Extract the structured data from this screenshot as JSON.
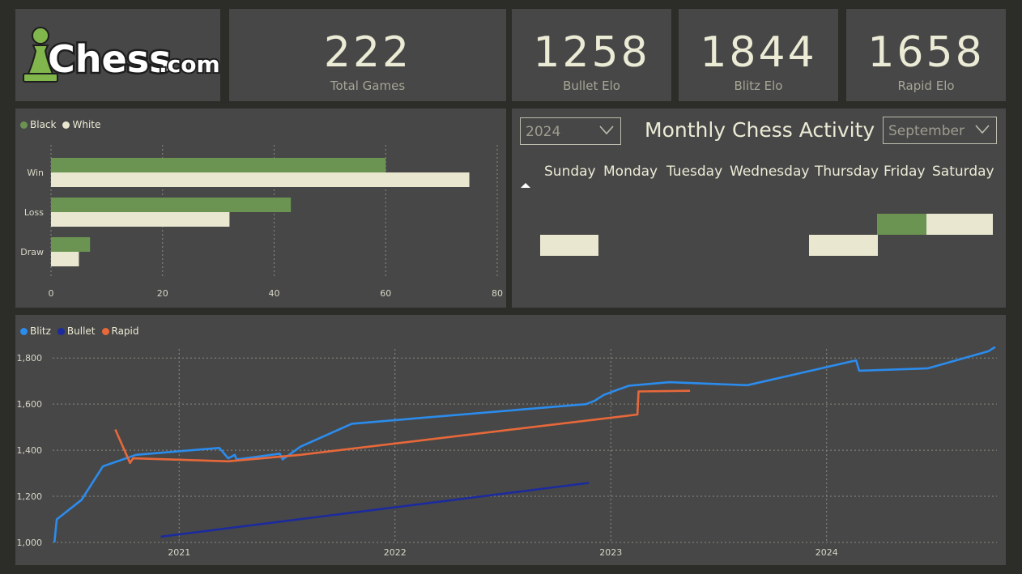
{
  "brand": {
    "logo_text": "Chess",
    "logo_suffix": ".com"
  },
  "kpis": [
    {
      "value": "222",
      "label": "Total Games"
    },
    {
      "value": "1258",
      "label": "Bullet Elo"
    },
    {
      "value": "1844",
      "label": "Blitz Elo"
    },
    {
      "value": "1658",
      "label": "Rapid Elo"
    }
  ],
  "colors": {
    "black": "#6b9452",
    "white": "#e9e7cf",
    "blitz": "#2b8ced",
    "bullet": "#1b2b9e",
    "rapid": "#e8683a",
    "panel": "#474747",
    "background": "#2c2c28"
  },
  "results_chart": {
    "legend": [
      "Black",
      "White"
    ],
    "categories": [
      "Win",
      "Loss",
      "Draw"
    ],
    "series": [
      {
        "name": "Black",
        "values": [
          60,
          43,
          7
        ]
      },
      {
        "name": "White",
        "values": [
          75,
          32,
          5
        ]
      }
    ],
    "x_ticks": [
      "0",
      "20",
      "40",
      "60",
      "80"
    ],
    "xlim": [
      0,
      80
    ]
  },
  "activity": {
    "title": "Monthly Chess Activity",
    "year_select": "2024",
    "month_select": "September",
    "days": [
      "Sunday",
      "Monday",
      "Tuesday",
      "Wednesday",
      "Thursday",
      "Friday",
      "Saturday"
    ],
    "sort_icon": "sort-up-icon"
  },
  "chart_data": [
    {
      "type": "bar",
      "orientation": "horizontal",
      "categories": [
        "Win",
        "Loss",
        "Draw"
      ],
      "series": [
        {
          "name": "Black",
          "values": [
            60,
            43,
            7
          ]
        },
        {
          "name": "White",
          "values": [
            75,
            32,
            5
          ]
        }
      ],
      "xlim": [
        0,
        80
      ],
      "legend": "top-left",
      "grid": true
    },
    {
      "type": "line",
      "legend": "top-left",
      "grid": true,
      "ylim": [
        1000,
        1850
      ],
      "y_ticks": [
        "1,000",
        "1,200",
        "1,400",
        "1,600",
        "1,800"
      ],
      "x_ticks": [
        "2021",
        "2022",
        "2023",
        "2024"
      ],
      "x_tick_values": [
        "2021-01-01",
        "2022-01-01",
        "2023-01-01",
        "2024-01-01"
      ],
      "xlim": [
        "2020-06-01",
        "2024-10-15"
      ],
      "series": [
        {
          "name": "Blitz",
          "points": [
            [
              "2020-06-04",
              1000
            ],
            [
              "2020-06-08",
              1100
            ],
            [
              "2020-07-20",
              1185
            ],
            [
              "2020-08-25",
              1330
            ],
            [
              "2020-10-20",
              1380
            ],
            [
              "2021-03-10",
              1410
            ],
            [
              "2021-03-25",
              1365
            ],
            [
              "2021-04-05",
              1380
            ],
            [
              "2021-04-08",
              1360
            ],
            [
              "2021-06-20",
              1385
            ],
            [
              "2021-06-25",
              1360
            ],
            [
              "2021-07-25",
              1415
            ],
            [
              "2021-10-20",
              1515
            ],
            [
              "2022-11-20",
              1600
            ],
            [
              "2022-12-05",
              1615
            ],
            [
              "2022-12-20",
              1640
            ],
            [
              "2023-01-10",
              1660
            ],
            [
              "2023-02-01",
              1680
            ],
            [
              "2023-04-10",
              1695
            ],
            [
              "2023-08-20",
              1682
            ],
            [
              "2024-02-20",
              1790
            ],
            [
              "2024-02-25",
              1745
            ],
            [
              "2024-06-20",
              1755
            ],
            [
              "2024-10-01",
              1830
            ],
            [
              "2024-10-12",
              1848
            ]
          ]
        },
        {
          "name": "Bullet",
          "points": [
            [
              "2020-12-01",
              1025
            ],
            [
              "2022-11-25",
              1258
            ]
          ]
        },
        {
          "name": "Rapid",
          "points": [
            [
              "2020-09-15",
              1490
            ],
            [
              "2020-10-10",
              1345
            ],
            [
              "2020-10-15",
              1365
            ],
            [
              "2021-03-25",
              1352
            ],
            [
              "2021-07-25",
              1380
            ],
            [
              "2023-02-15",
              1555
            ],
            [
              "2023-02-17",
              1655
            ],
            [
              "2023-05-15",
              1658
            ]
          ]
        }
      ]
    }
  ]
}
